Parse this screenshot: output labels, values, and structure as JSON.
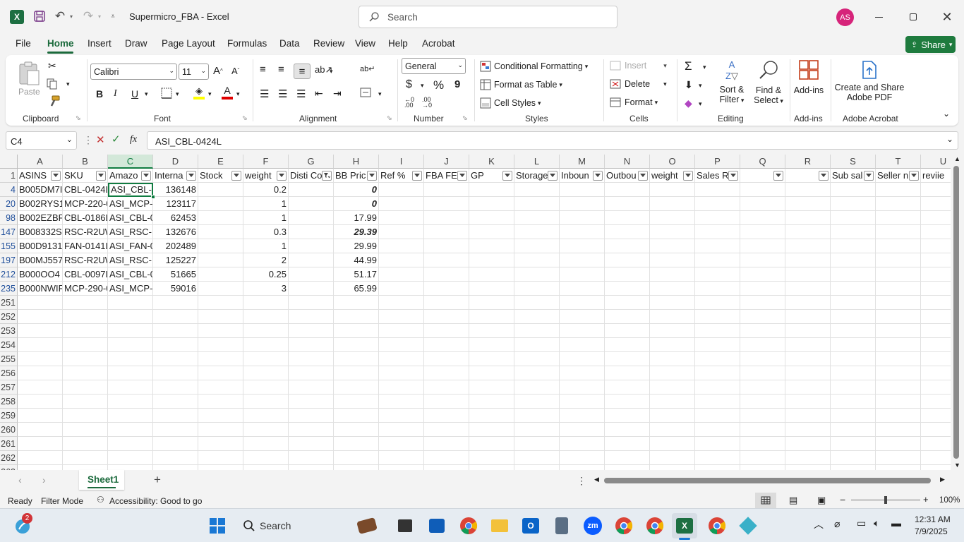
{
  "title": {
    "doc_name": "Supermicro_FBA",
    "separator": " - ",
    "app_name": "Excel",
    "search_placeholder": "Search",
    "avatar_initials": "AS"
  },
  "menu": [
    "File",
    "Home",
    "Insert",
    "Draw",
    "Page Layout",
    "Formulas",
    "Data",
    "Review",
    "View",
    "Help",
    "Acrobat"
  ],
  "share_label": "Share",
  "ribbon": {
    "clipboard": {
      "paste": "Paste",
      "label": "Clipboard"
    },
    "font": {
      "name": "Calibri",
      "size": "11",
      "bold": "B",
      "italic": "I",
      "underline": "U",
      "label": "Font"
    },
    "alignment": {
      "label": "Alignment"
    },
    "number": {
      "format": "General",
      "currency": "$",
      "percent": "%",
      "comma": "9",
      "label": "Number"
    },
    "styles": {
      "conditional": "Conditional Formatting",
      "format_table": "Format as Table",
      "cell_styles": "Cell Styles",
      "label": "Styles"
    },
    "cells": {
      "insert": "Insert",
      "delete": "Delete",
      "format": "Format",
      "label": "Cells"
    },
    "editing": {
      "sort1": "Sort &",
      "sort2": "Filter",
      "find1": "Find &",
      "find2": "Select",
      "label": "Editing"
    },
    "addins": {
      "button": "Add-ins",
      "label": "Add-ins"
    },
    "acrobat": {
      "line1": "Create and Share",
      "line2": "Adobe PDF",
      "label": "Adobe Acrobat"
    }
  },
  "formula_bar": {
    "name_box": "C4",
    "fx": "fx",
    "value": "ASI_CBL-0424L"
  },
  "columns": [
    "A",
    "B",
    "C",
    "D",
    "E",
    "F",
    "G",
    "H",
    "I",
    "J",
    "K",
    "L",
    "M",
    "N",
    "O",
    "P",
    "Q",
    "R",
    "S",
    "T",
    "U"
  ],
  "header_row": {
    "row_number": "1",
    "cells": [
      "ASINS",
      "SKU",
      "Amazo",
      "Interna",
      "Stock",
      "weight",
      "Disti Co",
      "BB Pric",
      "Ref %",
      "FBA FEE",
      "GP",
      "Storage",
      "Inboun",
      "Outbou",
      "weight",
      "Sales R",
      "",
      "",
      "Sub sal",
      "Seller n",
      "reviie"
    ]
  },
  "data_rows": [
    {
      "row": "4",
      "A": "B005DM7I",
      "B": "CBL-0424L",
      "C": "ASI_CBL-0",
      "D": "136148",
      "F": "0.2",
      "H": "0",
      "h_bi": true
    },
    {
      "row": "20",
      "A": "B002RYS1",
      "B": "MCP-220-0",
      "C": "ASI_MCP-",
      "D": "123117",
      "F": "1",
      "H": "0",
      "h_bi": true
    },
    {
      "row": "98",
      "A": "B002EZBP",
      "B": "CBL-0186L",
      "C": "ASI_CBL-0",
      "D": "62453",
      "F": "1",
      "H": "17.99",
      "h_bi": false
    },
    {
      "row": "147",
      "A": "B008332S",
      "B": "RSC-R2UW",
      "C": "ASI_RSC-R",
      "D": "132676",
      "F": "0.3",
      "H": "29.39",
      "h_bi": true
    },
    {
      "row": "155",
      "A": "B00D9131",
      "B": "FAN-0141L",
      "C": "ASI_FAN-0",
      "D": "202489",
      "F": "1",
      "H": "29.99",
      "h_bi": false
    },
    {
      "row": "197",
      "A": "B00MJ557",
      "B": "RSC-R2UW",
      "C": "ASI_RSC-R",
      "D": "125227",
      "F": "2",
      "H": "44.99",
      "h_bi": false
    },
    {
      "row": "212",
      "A": "B000OO4",
      "B": "CBL-0097L",
      "C": "ASI_CBL-0",
      "D": "51665",
      "F": "0.25",
      "H": "51.17",
      "h_bi": false
    },
    {
      "row": "235",
      "A": "B000NWIF",
      "B": "MCP-290-0",
      "C": "ASI_MCP-",
      "D": "59016",
      "F": "3",
      "H": "65.99",
      "h_bi": false
    }
  ],
  "empty_rows": [
    "251",
    "252",
    "253",
    "254",
    "255",
    "256",
    "257",
    "258",
    "259",
    "260",
    "261",
    "262",
    "263"
  ],
  "sheet_tab": "Sheet1",
  "status": {
    "ready": "Ready",
    "mode": "Filter Mode",
    "accessibility": "Accessibility: Good to go",
    "zoom": "100%",
    "zoom_level": 0.5
  },
  "taskbar": {
    "search": "Search",
    "time": "12:31 AM",
    "date": "7/9/2025",
    "badge": "2"
  },
  "colors": {
    "excel_green": "#217346",
    "share_green": "#1e7b3e",
    "avatar": "#d6247a",
    "selection": "#107c41"
  }
}
